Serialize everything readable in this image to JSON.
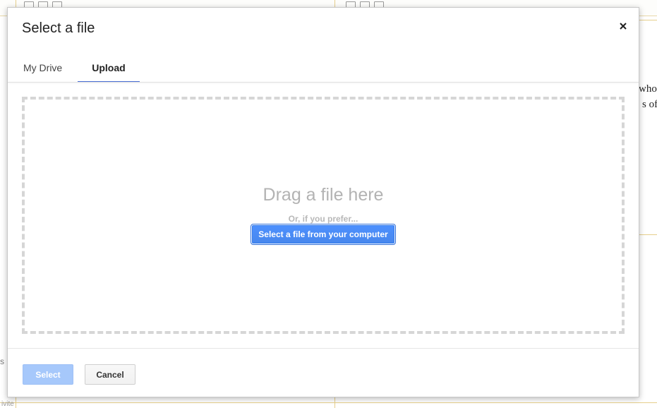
{
  "dialog": {
    "title": "Select a file",
    "close_symbol": "×"
  },
  "tabs": [
    {
      "label": "My Drive",
      "active": false
    },
    {
      "label": "Upload",
      "active": true
    }
  ],
  "upload": {
    "drop_title": "Drag a file here",
    "prefer_text": "Or, if you prefer...",
    "computer_button_label": "Select a file from your computer"
  },
  "footer": {
    "select_label": "Select",
    "cancel_label": "Cancel"
  },
  "background": {
    "right_text_line1": "who l",
    "right_text_line2": "s of",
    "left_fragment": "s",
    "bottom_fragment": "ivite"
  },
  "colors": {
    "accent_blue": "#4d90fe",
    "tab_underline": "#4a6fd6",
    "disabled_blue": "#a6c8fb"
  },
  "icons": {
    "close": "close-icon"
  }
}
